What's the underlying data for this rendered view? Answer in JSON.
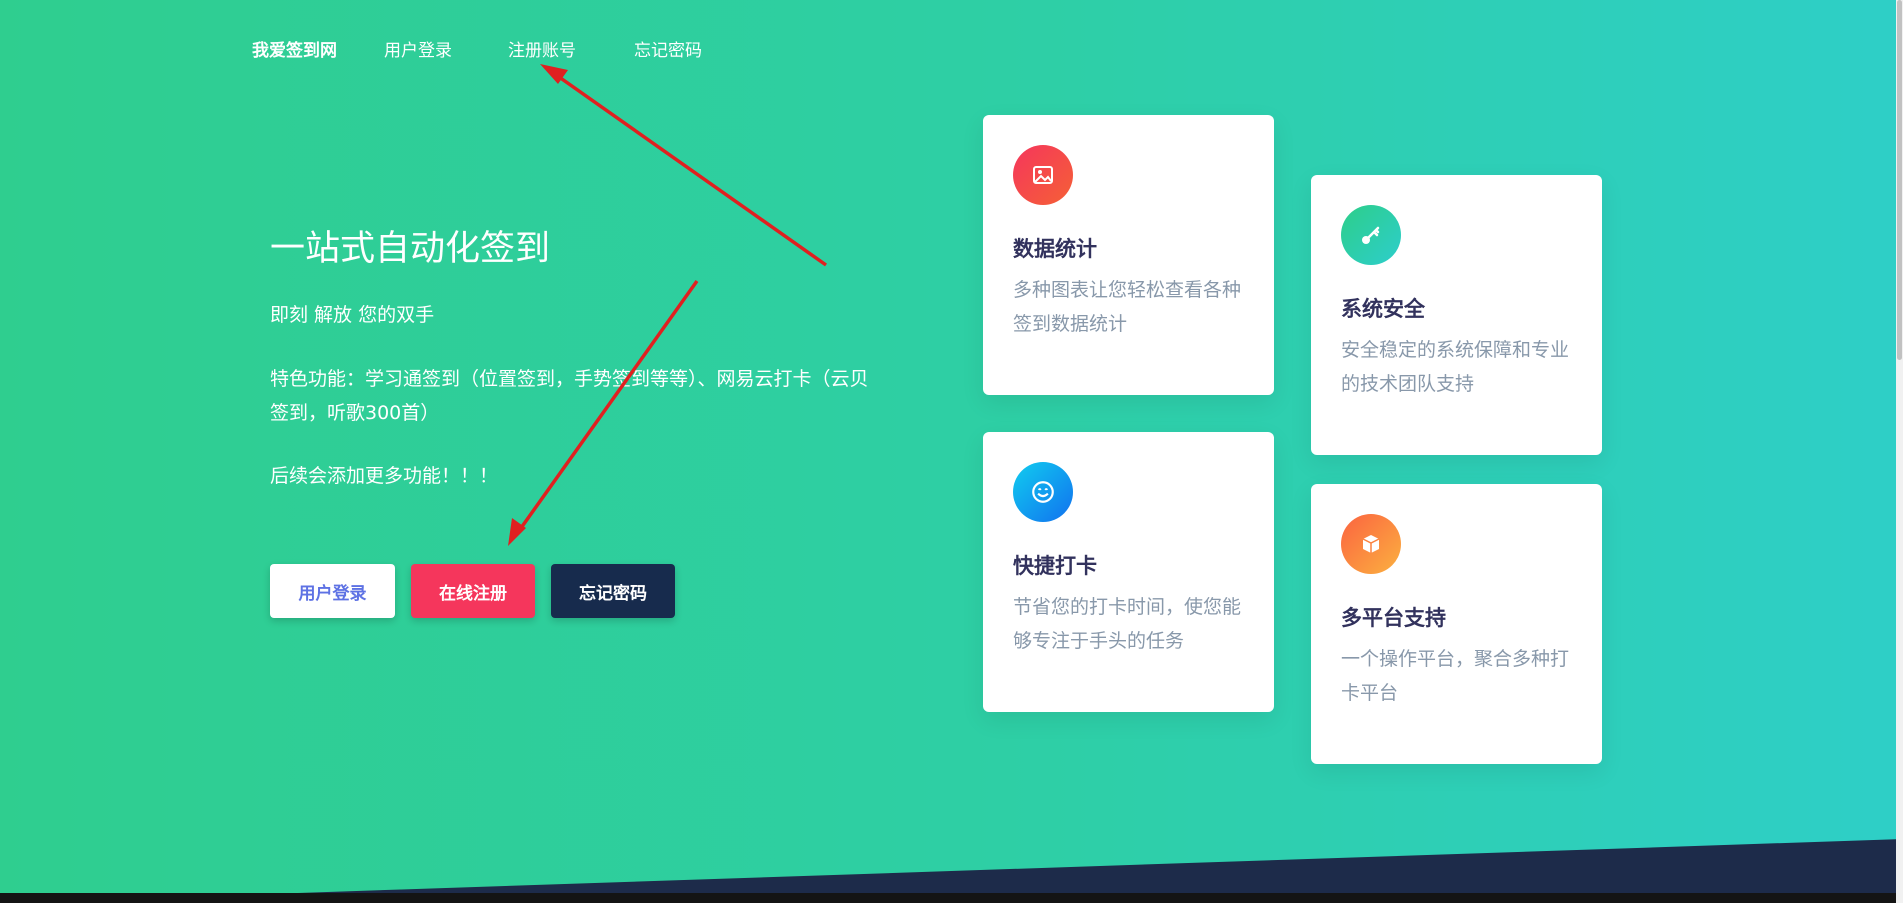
{
  "nav": {
    "brand": "我爱签到网",
    "items": [
      {
        "label": "用户登录"
      },
      {
        "label": "注册账号"
      },
      {
        "label": "忘记密码"
      }
    ]
  },
  "hero": {
    "headline": "一站式自动化签到",
    "line1": "即刻 解放 您的双手",
    "line2": "特色功能：学习通签到（位置签到，手势签到等等）、网易云打卡（云贝签到，听歌300首）",
    "line3": "后续会添加更多功能！！！"
  },
  "buttons": {
    "login": "用户登录",
    "register": "在线注册",
    "forgot": "忘记密码"
  },
  "cards": [
    {
      "title": "数据统计",
      "desc": "多种图表让您轻松查看各种签到数据统计",
      "icon": "image-icon",
      "color": "#f5365c"
    },
    {
      "title": "系统安全",
      "desc": "安全稳定的系统保障和专业的技术团队支持",
      "icon": "key-icon",
      "color": "#2dce89"
    },
    {
      "title": "快捷打卡",
      "desc": "节省您的打卡时间，使您能够专注于手头的任务",
      "icon": "smile-icon",
      "color": "#11cdef"
    },
    {
      "title": "多平台支持",
      "desc": "一个操作平台，聚合多种打卡平台",
      "icon": "box-icon",
      "color": "#fb6340"
    }
  ],
  "colors": {
    "accent_red": "#f5365c",
    "accent_dark": "#172b4d",
    "accent_primary": "#5e72e4",
    "arrow": "#e02020"
  }
}
